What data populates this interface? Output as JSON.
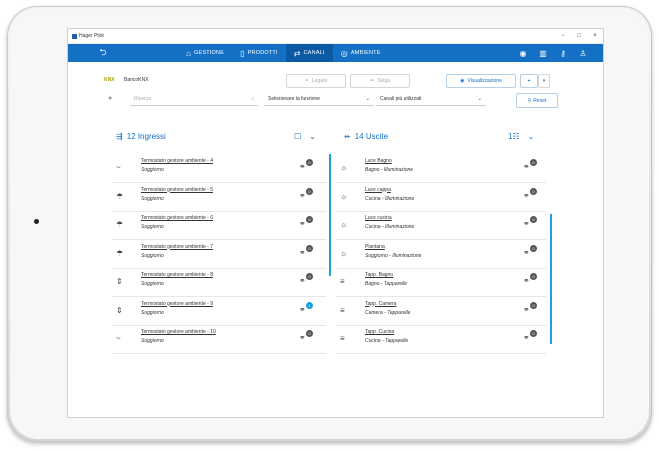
{
  "window": {
    "title": "Hager Pilot",
    "controls": [
      "−",
      "□",
      "×"
    ]
  },
  "nav": {
    "back": "⮌",
    "tabs": [
      {
        "label": "GESTIONE",
        "icon": "home-icon"
      },
      {
        "label": "PRODOTTI",
        "icon": "products-icon"
      },
      {
        "label": "CANALI",
        "icon": "channels-icon"
      },
      {
        "label": "AMBIENTE",
        "icon": "location-icon"
      }
    ],
    "active_tab": "CANALI",
    "right_icons": [
      "eye-icon",
      "book-icon",
      "key-icon",
      "user-icon"
    ]
  },
  "toolbar": {
    "project": "BancoKNX",
    "legare": "Legare",
    "slega": "Slega",
    "visualizzazione": "Visualizzazione",
    "search_placeholder": "Ricerca",
    "function_select": "Selezionare la funzione",
    "channels_select": "Canali più utilizzati",
    "reset": "Reset"
  },
  "inputs": {
    "header": "12 Ingressi",
    "rows": [
      {
        "title": "Termostato gestore ambiente - 4",
        "sub": "Soggiorno",
        "icon": "~",
        "badge": "0"
      },
      {
        "title": "Termostato gestore ambiente - 5",
        "sub": "Soggiorno",
        "icon": "☂",
        "badge": "0"
      },
      {
        "title": "Termostato gestore ambiente - 6",
        "sub": "Soggiorno",
        "icon": "☂",
        "badge": "0"
      },
      {
        "title": "Termostato gestore ambiente - 7",
        "sub": "Soggiorno",
        "icon": "☂",
        "badge": "0"
      },
      {
        "title": "Termostato gestore ambiente - 8",
        "sub": "Soggiorno",
        "icon": "⇕",
        "badge": "0"
      },
      {
        "title": "Termostato gestore ambiente - 9",
        "sub": "Soggiorno",
        "icon": "⇕",
        "badge": "1",
        "highlight": true
      },
      {
        "title": "Termostato gestore ambiente - 10",
        "sub": "Soggiorno",
        "icon": "~",
        "badge": "0"
      }
    ]
  },
  "outputs": {
    "header": "14 Uscite",
    "count_icon": "1",
    "rows": [
      {
        "title": "Luce Bagno",
        "sub": "Bagno - Illuminazione",
        "icon": "☼",
        "badge": "0"
      },
      {
        "title": "Luce cappa",
        "sub": "Cucina - Illuminazione",
        "icon": "☼",
        "badge": "0"
      },
      {
        "title": "Luce cucina",
        "sub": "Cucina - Illuminazione",
        "icon": "☼",
        "badge": "0"
      },
      {
        "title": "Plantana",
        "sub": "Soggiorno - Illuminazione",
        "icon": "☼",
        "badge": "0"
      },
      {
        "title": "Tapp. Bagno",
        "sub": "Bagno - Tapparelle",
        "icon": "≡",
        "badge": "0"
      },
      {
        "title": "Tapp. Camera",
        "sub": "Camera - Tapparelle",
        "icon": "≡",
        "badge": "0"
      },
      {
        "title": "Tapp. Cucina",
        "sub": "Cucina - Tapparelle",
        "icon": "≡",
        "badge": "0"
      }
    ]
  },
  "colors": {
    "accent": "#1470c4",
    "scroll": "#1aa3d8",
    "badge": "#555555",
    "badge_active": "#1e9be0"
  }
}
